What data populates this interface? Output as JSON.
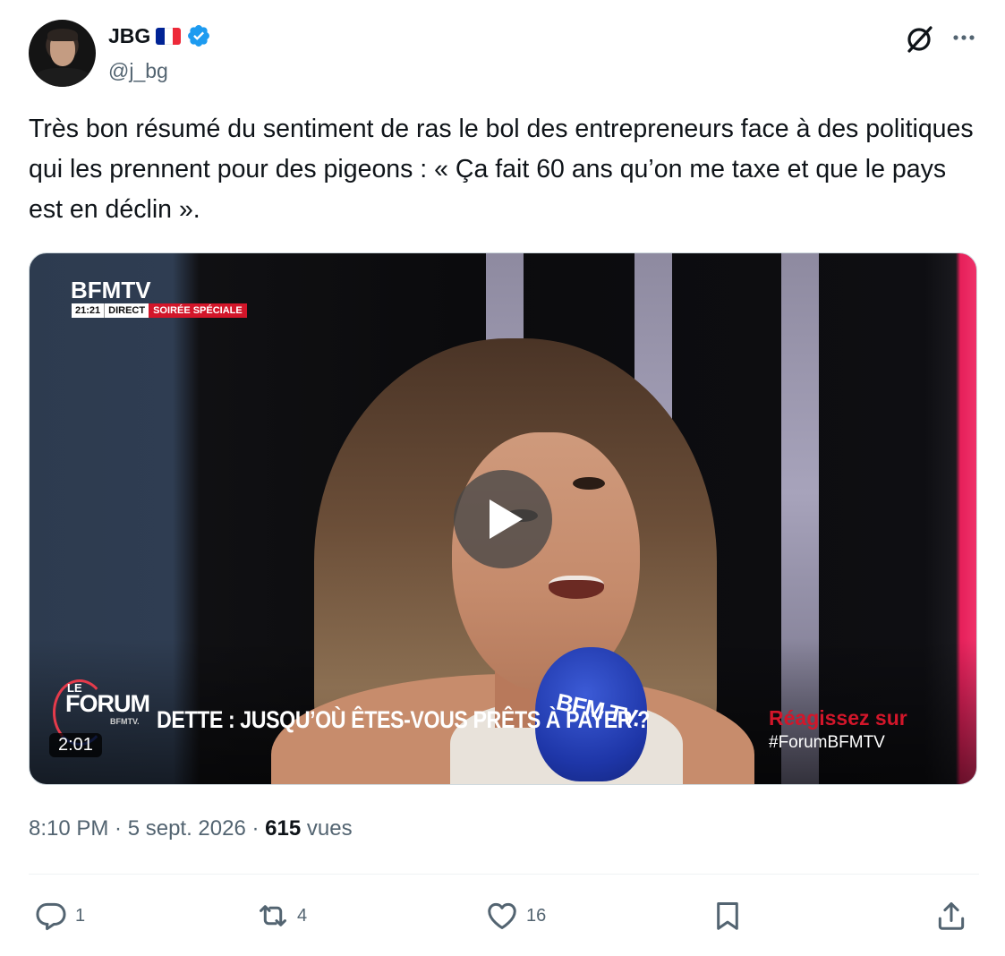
{
  "author": {
    "display_name": "JBG",
    "handle": "@j_bg",
    "flag_colors": [
      "#002395",
      "#ffffff",
      "#ed2939"
    ],
    "verified_color": "#1d9bf0"
  },
  "tweet": {
    "text": "Très bon résumé du sentiment de ras le bol des entrepreneurs face à des politiques qui les prennent pour des pigeons : « Ça fait 60 ans qu’on me taxe et que le pays est en déclin »."
  },
  "video": {
    "channel_logo": "BFMTV",
    "live_time": "21:21",
    "live_label": "DIRECT",
    "special_label": "SOIRÉE SPÉCIALE",
    "forum_le": "LE",
    "forum_word": "FORUM",
    "forum_sub": "BFMTV.",
    "banner": "DETTE : JUSQU’OÙ ÊTES-VOUS PRÊTS À PAYER ?",
    "react_line1": "Réagissez sur",
    "react_line2": "#ForumBFMTV",
    "mic_text": "BFM TV.",
    "duration": "2:01"
  },
  "meta": {
    "time": "8:10 PM",
    "separator": " · ",
    "date": "5 sept. 2026",
    "views_count": "615",
    "views_label": "vues"
  },
  "actions": {
    "replies": "1",
    "reposts": "4",
    "likes": "16"
  },
  "colors": {
    "text_primary": "#0f1419",
    "text_secondary": "#536471",
    "accent_red": "#d3162a"
  }
}
